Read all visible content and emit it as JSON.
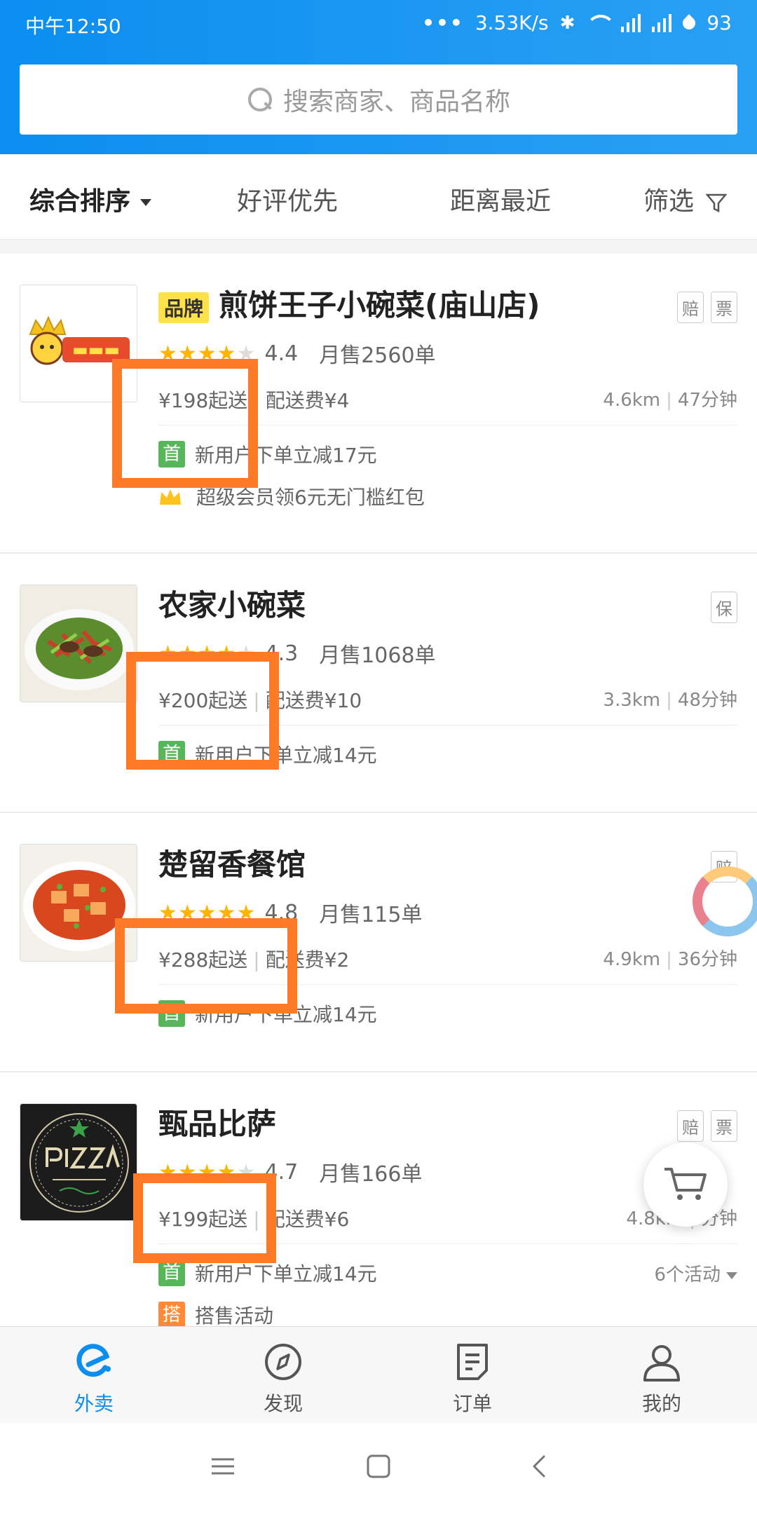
{
  "status": {
    "time": "中午12:50",
    "speed": "3.53K/s",
    "battery": "93"
  },
  "search": {
    "placeholder": "搜索商家、商品名称"
  },
  "sort": {
    "items": [
      "综合排序",
      "好评优先",
      "距离最近",
      "筛选"
    ]
  },
  "shops": [
    {
      "brand_badge": "品牌",
      "name": "煎饼王子小碗菜(庙山店)",
      "tags": [
        "赔",
        "票"
      ],
      "rating": "4.4",
      "monthly_sales": "月售2560单",
      "min_order": "¥198起送",
      "delivery_fee": "配送费¥4",
      "distance": "4.6km",
      "time": "47分钟",
      "promos": [
        {
          "icon": "首",
          "text": "新用户下单立减17元"
        },
        {
          "icon": "crown",
          "text": "超级会员领6元无门槛红包"
        }
      ]
    },
    {
      "name": "农家小碗菜",
      "tags": [
        "保"
      ],
      "rating": "4.3",
      "monthly_sales": "月售1068单",
      "min_order": "¥200起送",
      "delivery_fee": "配送费¥10",
      "distance": "3.3km",
      "time": "48分钟",
      "promos": [
        {
          "icon": "首",
          "text": "新用户下单立减14元"
        }
      ]
    },
    {
      "name": "楚留香餐馆",
      "tags": [
        "赔"
      ],
      "rating": "4.8",
      "monthly_sales": "月售115单",
      "min_order": "¥288起送",
      "delivery_fee": "配送费¥2",
      "distance": "4.9km",
      "time": "36分钟",
      "promos": [
        {
          "icon": "首",
          "text": "新用户下单立减14元"
        }
      ]
    },
    {
      "name": "甄品比萨",
      "tags": [
        "赔",
        "票"
      ],
      "rating": "4.7",
      "monthly_sales": "月售166单",
      "min_order": "¥199起送",
      "delivery_fee": "配送费¥6",
      "distance": "4.8km",
      "time": "分钟",
      "activities": "6个活动",
      "promos": [
        {
          "icon": "首",
          "text": "新用户下单立减14元"
        },
        {
          "icon": "搭",
          "text": "搭售活动"
        }
      ]
    }
  ],
  "tabbar": [
    "外卖",
    "发现",
    "订单",
    "我的"
  ],
  "colors": {
    "brand_blue": "#0b8ef0",
    "highlight_orange": "#ff7a26",
    "star": "#ffb400",
    "promo_green": "#58b65a"
  }
}
